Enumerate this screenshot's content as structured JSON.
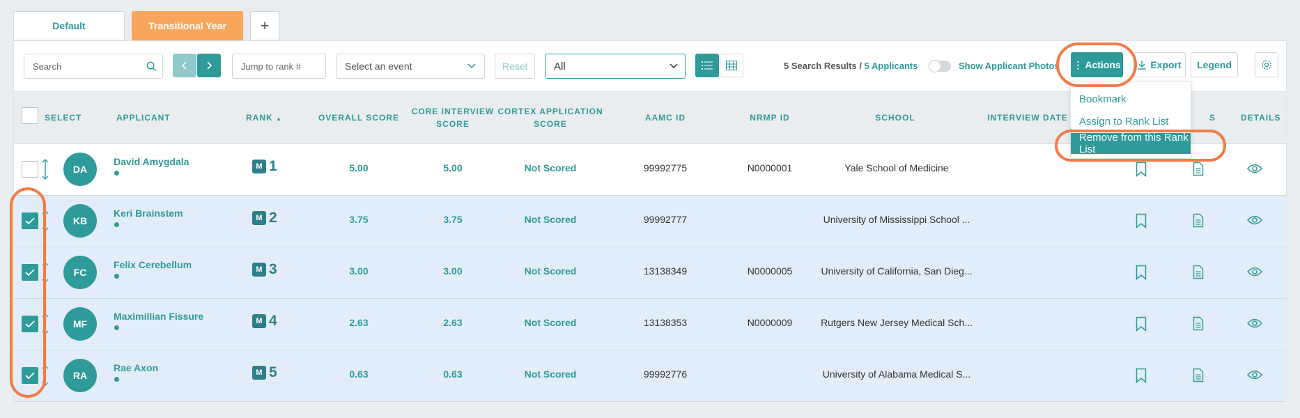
{
  "tabs": [
    {
      "label": "Default"
    },
    {
      "label": "Transitional Year"
    }
  ],
  "add_tab_label": "+",
  "toolbar": {
    "search_placeholder": "Search",
    "jump_placeholder": "Jump to rank #",
    "event_placeholder": "Select an event",
    "reset_label": "Reset",
    "filter_value": "All",
    "results_text": "5 Search Results /",
    "applicants_link": "5 Applicants",
    "show_photos_label": "Show Applicant Photos",
    "actions_label": "Actions",
    "export_label": "Export",
    "legend_label": "Legend"
  },
  "columns": {
    "select": "SELECT",
    "applicant": "APPLICANT",
    "rank": "RANK",
    "overall": "OVERALL SCORE",
    "core1": "CORE INTERVIEW",
    "core2": "SCORE",
    "cortex1": "CORTEX APPLICATION",
    "cortex2": "SCORE",
    "aamc": "AAMC ID",
    "nrmp": "NRMP ID",
    "school": "SCHOOL",
    "interview_date": "INTERVIEW DATE",
    "notes_tail": "S",
    "details": "DETAILS"
  },
  "actions_menu": [
    {
      "label": "Bookmark"
    },
    {
      "label": "Assign to Rank List"
    },
    {
      "label": "Remove from this Rank List"
    }
  ],
  "rows": [
    {
      "initials": "DA",
      "name": "David Amygdala",
      "badge": "M",
      "rank": "1",
      "overall": "5.00",
      "core": "5.00",
      "cortex": "Not Scored",
      "aamc": "99992775",
      "nrmp": "N0000001",
      "school": "Yale School of Medicine",
      "selected": false
    },
    {
      "initials": "KB",
      "name": "Keri Brainstem",
      "badge": "M",
      "rank": "2",
      "overall": "3.75",
      "core": "3.75",
      "cortex": "Not Scored",
      "aamc": "99992777",
      "nrmp": "",
      "school": "University of Mississippi School ...",
      "selected": true
    },
    {
      "initials": "FC",
      "name": "Felix Cerebellum",
      "badge": "M",
      "rank": "3",
      "overall": "3.00",
      "core": "3.00",
      "cortex": "Not Scored",
      "aamc": "13138349",
      "nrmp": "N0000005",
      "school": "University of California, San Dieg...",
      "selected": true
    },
    {
      "initials": "MF",
      "name": "Maximillian Fissure",
      "badge": "M",
      "rank": "4",
      "overall": "2.63",
      "core": "2.63",
      "cortex": "Not Scored",
      "aamc": "13138353",
      "nrmp": "N0000009",
      "school": "Rutgers New Jersey Medical Sch...",
      "selected": true
    },
    {
      "initials": "RA",
      "name": "Rae Axon",
      "badge": "M",
      "rank": "5",
      "overall": "0.63",
      "core": "0.63",
      "cortex": "Not Scored",
      "aamc": "99992776",
      "nrmp": "",
      "school": "University of Alabama Medical S...",
      "selected": true
    }
  ],
  "colors": {
    "teal": "#2e9a9a",
    "orange_tab": "#f8a65c",
    "highlight_ring": "#f47a45",
    "selected_row": "#e2edf9"
  }
}
